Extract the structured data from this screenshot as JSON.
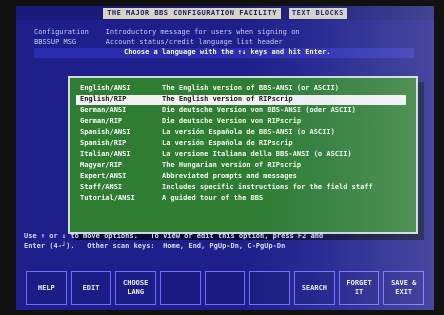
{
  "window": {
    "title_main": "THE MAJOR BBS CONFIGURATION FACILITY",
    "title_section": "TEXT BLOCKS"
  },
  "header": {
    "line1": "Configuration    Introductory message for users when signing on",
    "line2": "BBSSUP MSG       Account status/credit language list header",
    "prompt": "Choose a language with the ↑↓ keys and hit Enter."
  },
  "languages": [
    {
      "key": "English/ANSI",
      "desc": "The English version of BBS-ANSI (or ASCII)",
      "selected": false
    },
    {
      "key": "English/RIP",
      "desc": "The English version of RIPscrip",
      "selected": true
    },
    {
      "key": "German/ANSI",
      "desc": "Die deutsche Version von BBS-ANSI (oder ASCII)",
      "selected": false
    },
    {
      "key": "German/RIP",
      "desc": "Die deutsche Version von RIPscrip",
      "selected": false
    },
    {
      "key": "Spanish/ANSI",
      "desc": "La versión Española de BBS-ANSI (o ASCII)",
      "selected": false
    },
    {
      "key": "Spanish/RIP",
      "desc": "La versión Española de RIPscrip",
      "selected": false
    },
    {
      "key": "Italian/ANSI",
      "desc": "La versione Italiana della BBS-ANSI (o ASCII)",
      "selected": false
    },
    {
      "key": "Magyar/RIP",
      "desc": "The Hungarian version of RIPscrip",
      "selected": false
    },
    {
      "key": "Expert/ANSI",
      "desc": "Abbreviated prompts and messages",
      "selected": false
    },
    {
      "key": "Staff/ANSI",
      "desc": "Includes specific instructions for the field staff",
      "selected": false
    },
    {
      "key": "Tutorial/ANSI",
      "desc": "A guided tour of the BBS",
      "selected": false
    }
  ],
  "footer": {
    "help_line1": "Use ↑ or ↓ to move options.   To view or edit this option, press F2 and",
    "help_line2": "Enter (4-┘).   Other scan keys:  Home, End, PgUp-Dn, C-PgUp-Dn"
  },
  "function_keys": [
    {
      "label": "HELP"
    },
    {
      "label": "EDIT"
    },
    {
      "label": "CHOOSE\nLANG"
    },
    {
      "label": ""
    },
    {
      "label": ""
    },
    {
      "label": ""
    },
    {
      "label": "SEARCH"
    },
    {
      "label": "FORGET\nIT"
    },
    {
      "label": "SAVE &\nEXIT"
    }
  ],
  "colors": {
    "screen_bg": "#1e1f8a",
    "dialog_bg": "#2e7d32",
    "highlight_bg": "#f2f2f2"
  }
}
